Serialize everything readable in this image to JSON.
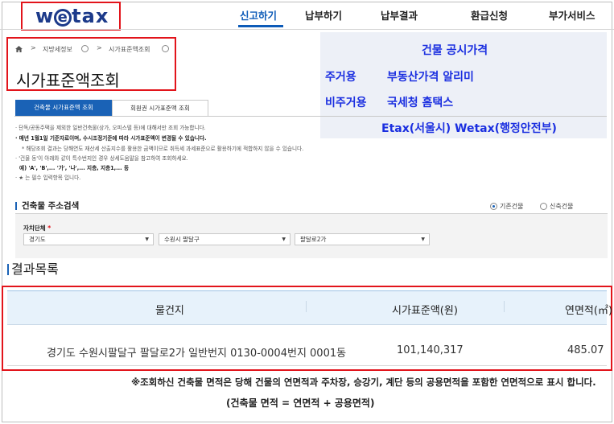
{
  "header": {
    "logo_text": "wetax",
    "nav": [
      "신고하기",
      "납부하기",
      "납부결과",
      "환급신청",
      "부가서비스"
    ],
    "active_nav": "신고하기"
  },
  "breadcrumb": {
    "home_icon": "home-icon",
    "items": [
      "지방세정보",
      "시가표준액조회"
    ]
  },
  "page_title": "시가표준액조회",
  "overlay": {
    "title": "건물 공시가격",
    "residential_label": "주거용",
    "residential_value": "부동산가격 알리미",
    "nonresidential_label": "비주거용",
    "nonresidential_value": "국세청 홈택스",
    "etax_line": "Etax(서울시) Wetax(행정안전부)"
  },
  "tabs": [
    "건축물 시가표준액 조회",
    "회원권 시가표준액 조회"
  ],
  "notes": [
    "· 단독/공동주택을 제외한 일반건축물(상가, 오피스텔 등)에 대해서만 조회 가능합니다.",
    "· 매년 1월1일 기준자료이며, 수시조정기준에 따라 시가표준액이 변경될 수 있습니다.",
    "* 해당조회 결과는 당해연도 재산세 산출지수를 활용한 금액이므로 취득세 과세표준으로 활용하기에 적합하지 않을 수 있습니다.",
    "· '건물 동'이 아래와 같이 특수번지인 경우 상세도움말을 참고하여 조회하세요.",
    "예) 'A', 'B',... '가', '나',... 지층, 지층1,... 등",
    "· ★ 는 필수 입력항목 입니다."
  ],
  "search": {
    "heading": "건축물 주소검색",
    "radio_options": [
      "기존건물",
      "신축건물"
    ],
    "selected_radio": "기존건물",
    "field_label": "자치단체",
    "required_mark": "*",
    "selects": [
      "경기도",
      "수원시 팔달구",
      "팔달로2가"
    ]
  },
  "results": {
    "heading": "결과목록",
    "columns": [
      "물건지",
      "시가표준액(원)",
      "연면적(㎡)"
    ],
    "rows": [
      {
        "address": "경기도 수원시팔달구 팔달로2가 일반번지 0130-0004번지 0001동",
        "value": "101,140,317",
        "area": "485.07"
      }
    ]
  },
  "footnote": {
    "line1": "※조회하신 건축물 면적은 당해 건물의 연면적과 주차장, 승강기, 계단 등의 공용면적을 포함한 연면적으로 표시 합니다.",
    "line2": "(건축물 면적 = 연면적 + 공용면적)"
  },
  "colors": {
    "accent_blue": "#1a62b6",
    "highlight_red": "#e2141b",
    "overlay_text": "#1b2fe0"
  }
}
